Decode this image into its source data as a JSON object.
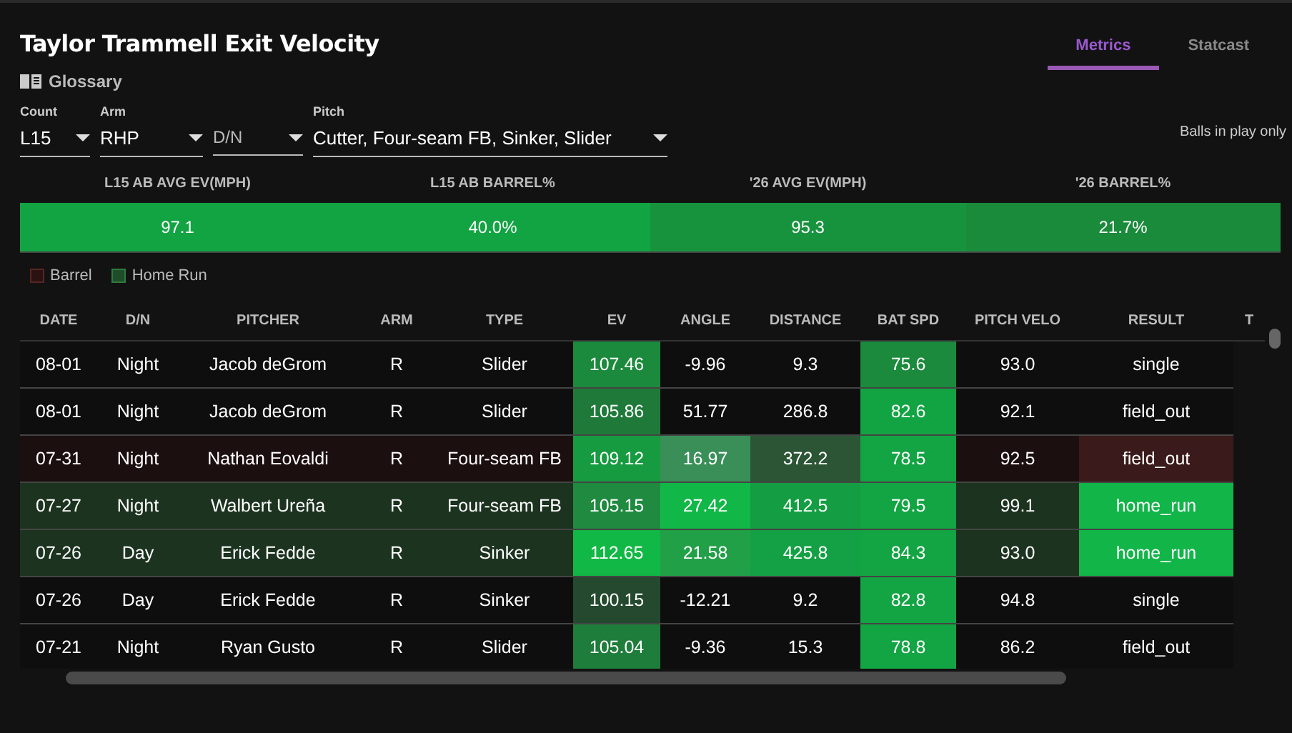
{
  "title": "Taylor Trammell Exit Velocity",
  "glossary": "Glossary",
  "tabs": [
    {
      "label": "Metrics",
      "selected": true
    },
    {
      "label": "Statcast",
      "selected": false
    }
  ],
  "filters": [
    {
      "label": "Count",
      "value": "L15"
    },
    {
      "label": "Arm",
      "value": "RHP"
    },
    {
      "placeholder": "D/N"
    },
    {
      "label": "Pitch",
      "value": "Cutter, Four-seam FB, Sinker, Slider"
    }
  ],
  "note": "Balls in play only",
  "summary": [
    {
      "label": "L15 AB AVG EV(MPH)",
      "value": "97.1",
      "color": "#12a442"
    },
    {
      "label": "L15 AB BARREL%",
      "value": "40.0%",
      "color": "#12a442"
    },
    {
      "label": "'26 AVG EV(MPH)",
      "value": "95.3",
      "color": "#17933e"
    },
    {
      "label": "'26 BARREL%",
      "value": "21.7%",
      "color": "#1a8a3b"
    }
  ],
  "legend": [
    {
      "label": "Barrel",
      "kind": "barrel"
    },
    {
      "label": "Home Run",
      "kind": "home_run"
    }
  ],
  "table": {
    "columns": [
      "DATE",
      "D/N",
      "PITCHER",
      "ARM",
      "TYPE",
      "EV",
      "ANGLE",
      "DISTANCE",
      "BAT SPD",
      "PITCH VELO",
      "RESULT",
      "T"
    ],
    "rows": [
      {
        "kind": "normal",
        "cells": [
          {
            "text": "08-01"
          },
          {
            "text": "Night"
          },
          {
            "text": "Jacob deGrom"
          },
          {
            "text": "R"
          },
          {
            "text": "Slider"
          },
          {
            "text": "107.46",
            "color": "#1c8a3c"
          },
          {
            "text": "-9.96"
          },
          {
            "text": "9.3"
          },
          {
            "text": "75.6",
            "color": "#1b8a3c"
          },
          {
            "text": "93.0"
          },
          {
            "text": "single"
          }
        ]
      },
      {
        "kind": "normal",
        "cells": [
          {
            "text": "08-01"
          },
          {
            "text": "Night"
          },
          {
            "text": "Jacob deGrom"
          },
          {
            "text": "R"
          },
          {
            "text": "Slider"
          },
          {
            "text": "105.86",
            "color": "#1f7a3a"
          },
          {
            "text": "51.77"
          },
          {
            "text": "286.8"
          },
          {
            "text": "82.6",
            "color": "#12a442"
          },
          {
            "text": "92.1"
          },
          {
            "text": "field_out"
          }
        ]
      },
      {
        "kind": "barrel",
        "cells": [
          {
            "text": "07-31"
          },
          {
            "text": "Night"
          },
          {
            "text": "Nathan Eovaldi"
          },
          {
            "text": "R"
          },
          {
            "text": "Four-seam FB"
          },
          {
            "text": "109.12",
            "color": "#169b40"
          },
          {
            "text": "16.97",
            "color": "#3a8f59"
          },
          {
            "text": "372.2",
            "color": "#2b5535"
          },
          {
            "text": "78.5",
            "color": "#13a443"
          },
          {
            "text": "92.5"
          },
          {
            "text": "field_out",
            "color": "#3a1a1a"
          }
        ]
      },
      {
        "kind": "home_run",
        "cells": [
          {
            "text": "07-27"
          },
          {
            "text": "Night"
          },
          {
            "text": "Walbert Ureña"
          },
          {
            "text": "R"
          },
          {
            "text": "Four-seam FB"
          },
          {
            "text": "105.15",
            "color": "#1f8a40"
          },
          {
            "text": "27.42",
            "color": "#12b847"
          },
          {
            "text": "412.5",
            "color": "#149d43"
          },
          {
            "text": "79.5",
            "color": "#13a443"
          },
          {
            "text": "99.1"
          },
          {
            "text": "home_run",
            "color": "#12b548"
          }
        ]
      },
      {
        "kind": "home_run",
        "cells": [
          {
            "text": "07-26"
          },
          {
            "text": "Day"
          },
          {
            "text": "Erick Fedde"
          },
          {
            "text": "R"
          },
          {
            "text": "Sinker"
          },
          {
            "text": "112.65",
            "color": "#11b845"
          },
          {
            "text": "21.58",
            "color": "#22a048"
          },
          {
            "text": "425.8",
            "color": "#14a044"
          },
          {
            "text": "84.3",
            "color": "#13a443"
          },
          {
            "text": "93.0"
          },
          {
            "text": "home_run",
            "color": "#12b548"
          }
        ]
      },
      {
        "kind": "normal",
        "cells": [
          {
            "text": "07-26"
          },
          {
            "text": "Day"
          },
          {
            "text": "Erick Fedde"
          },
          {
            "text": "R"
          },
          {
            "text": "Sinker"
          },
          {
            "text": "100.15",
            "color": "#24492f"
          },
          {
            "text": "-12.21"
          },
          {
            "text": "9.2"
          },
          {
            "text": "82.8",
            "color": "#13a443"
          },
          {
            "text": "94.8"
          },
          {
            "text": "single"
          }
        ]
      },
      {
        "kind": "normal",
        "cells": [
          {
            "text": "07-21"
          },
          {
            "text": "Night"
          },
          {
            "text": "Ryan Gusto"
          },
          {
            "text": "R"
          },
          {
            "text": "Slider"
          },
          {
            "text": "105.04",
            "color": "#1e7d3a"
          },
          {
            "text": "-9.36"
          },
          {
            "text": "15.3"
          },
          {
            "text": "78.8",
            "color": "#13a443"
          },
          {
            "text": "86.2"
          },
          {
            "text": "field_out"
          }
        ]
      }
    ]
  }
}
